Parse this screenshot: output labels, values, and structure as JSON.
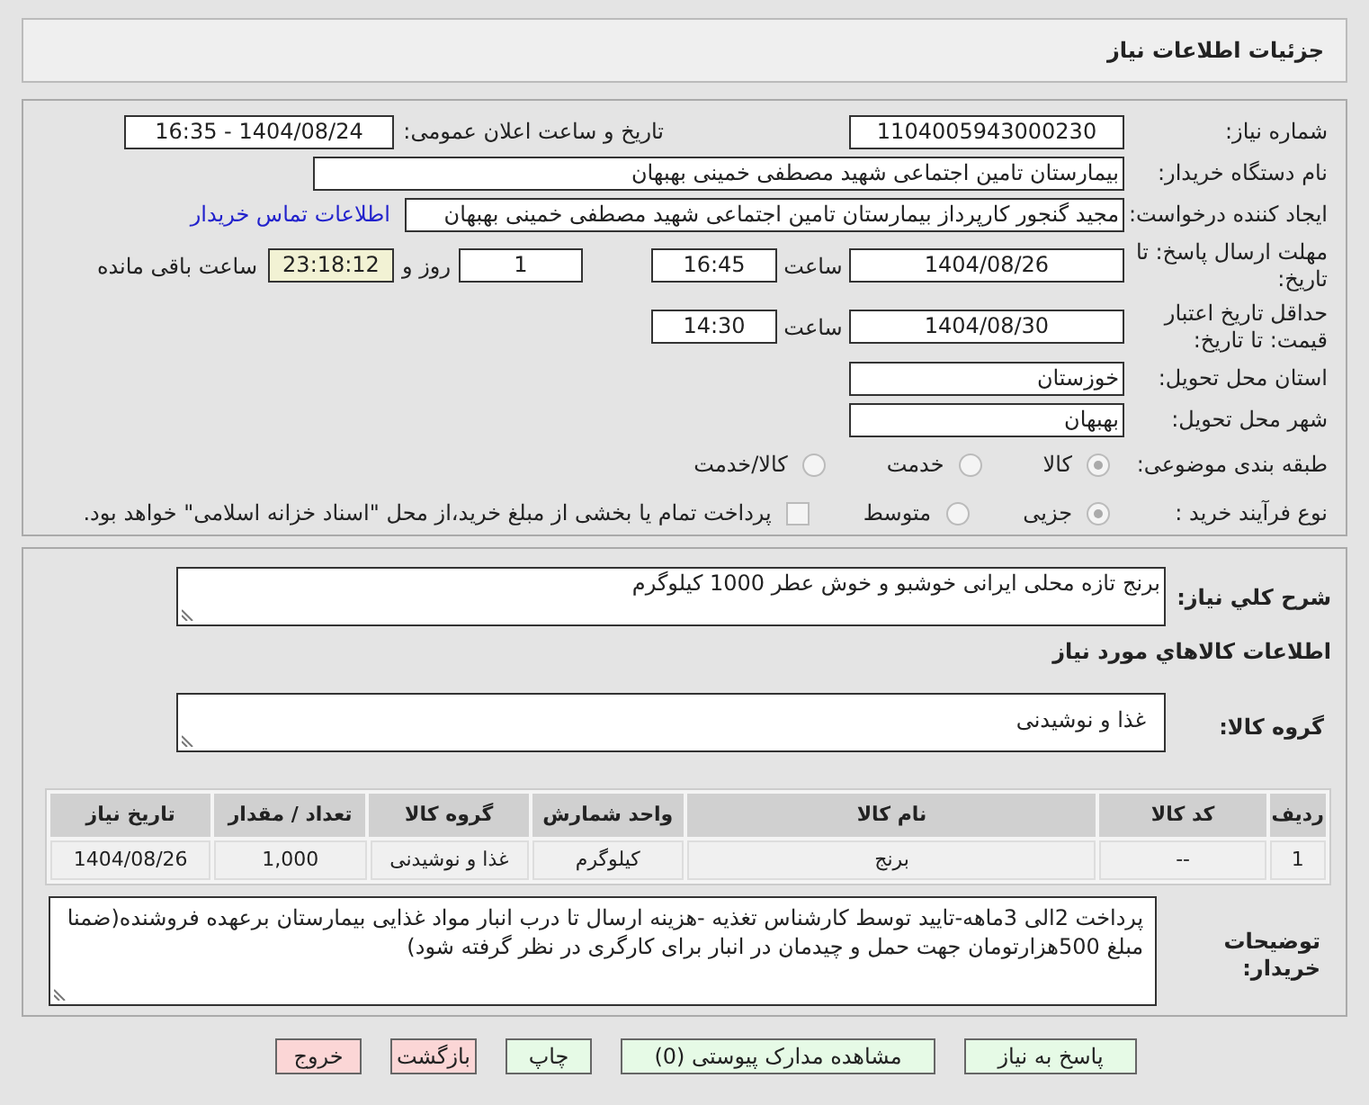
{
  "header": {
    "title": "جزئیات اطلاعات نیاز"
  },
  "need_number": {
    "label": "شماره نیاز:",
    "value": "1104005943000230"
  },
  "announcement": {
    "label": "تاریخ و ساعت اعلان عمومی:",
    "value": "1404/08/24 - 16:35"
  },
  "buyer_org": {
    "label": "نام دستگاه خریدار:",
    "value": "بیمارستان تامین اجتماعی شهید مصطفی خمینی بهبهان"
  },
  "requester": {
    "label": "ایجاد کننده درخواست:",
    "value": "مجید گنجور کارپرداز بیمارستان تامین اجتماعی شهید مصطفی خمینی بهبهان",
    "link": "اطلاعات تماس خریدار"
  },
  "response_deadline": {
    "label": "مهلت ارسال پاسخ: تا تاریخ:",
    "date": "1404/08/26",
    "time_label": "ساعت",
    "time": "16:45",
    "days": "1",
    "days_label": "روز و",
    "remaining": "23:18:12",
    "remaining_label": "ساعت باقی مانده"
  },
  "price_validity": {
    "label": "حداقل تاریخ اعتبار قیمت: تا تاریخ:",
    "date": "1404/08/30",
    "time_label": "ساعت",
    "time": "14:30"
  },
  "province": {
    "label": "استان محل تحویل:",
    "value": "خوزستان"
  },
  "city": {
    "label": "شهر محل تحویل:",
    "value": "بهبهان"
  },
  "category": {
    "label": "طبقه بندی موضوعی:",
    "options": [
      {
        "label": "کالا",
        "selected": true
      },
      {
        "label": "خدمت",
        "selected": false
      },
      {
        "label": "کالا/خدمت",
        "selected": false
      }
    ]
  },
  "purchase_type": {
    "label": "نوع فرآیند خرید :",
    "options": [
      {
        "label": "جزیی",
        "selected": true
      },
      {
        "label": "متوسط",
        "selected": false
      }
    ],
    "treasury": {
      "label": "پرداخت تمام یا بخشی از مبلغ خرید،از محل \"اسناد خزانه اسلامی\" خواهد بود.",
      "checked": false
    }
  },
  "description": {
    "label": "شرح کلي نیاز:",
    "value": "برنج تازه محلی ایرانی خوشبو و خوش عطر 1000 کیلوگرم"
  },
  "goods_heading": "اطلاعات کالاهاي مورد نیاز",
  "goods_group": {
    "label": "گروه کالا:",
    "value": "غذا و نوشیدنی"
  },
  "table": {
    "columns": [
      "ردیف",
      "کد کالا",
      "نام کالا",
      "واحد شمارش",
      "گروه کالا",
      "تعداد / مقدار",
      "تاریخ نیاز"
    ],
    "rows": [
      [
        "1",
        "--",
        "برنج",
        "کیلوگرم",
        "غذا و نوشیدنی",
        "1,000",
        "1404/08/26"
      ]
    ]
  },
  "buyer_notes": {
    "label": "توضیحات خریدار:",
    "value": "پرداخت 2الی 3ماهه-تایید توسط کارشناس تغذیه -هزینه ارسال تا درب انبار مواد غذایی بیمارستان برعهده فروشنده(ضمنا مبلغ 500هزارتومان جهت حمل و چیدمان در انبار برای کارگری در نظر گرفته شود)"
  },
  "buttons": [
    {
      "label": "پاسخ به نیاز",
      "color": "#e6fae6"
    },
    {
      "label": "مشاهده مدارک پیوستی (0)",
      "color": "#e6fae6"
    },
    {
      "label": "چاپ",
      "color": "#e6fae6"
    },
    {
      "label": "بازگشت",
      "color": "#fbd6d6"
    },
    {
      "label": "خروج",
      "color": "#fbd6d6"
    }
  ]
}
